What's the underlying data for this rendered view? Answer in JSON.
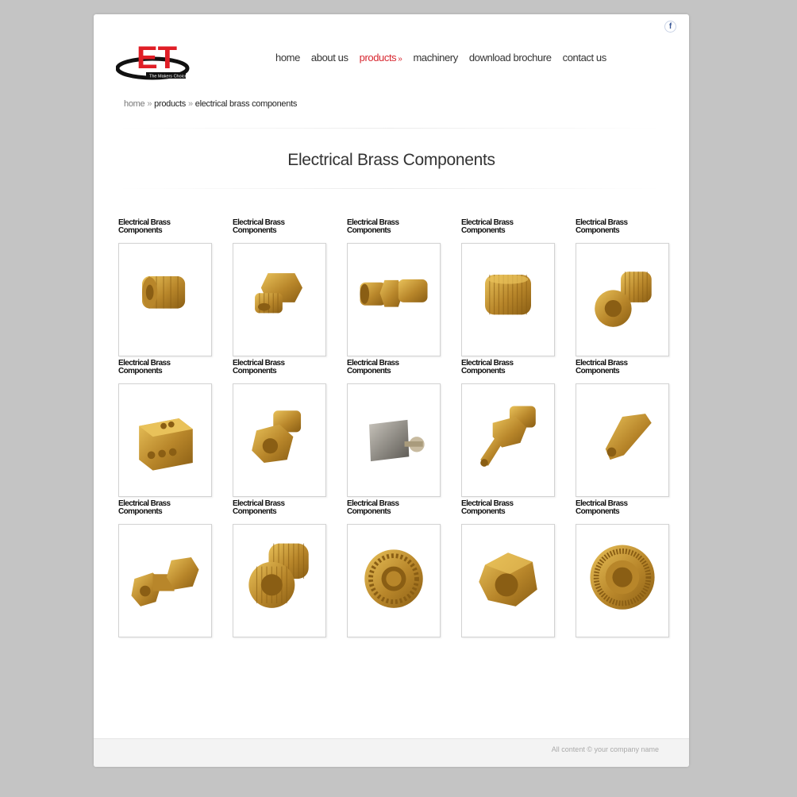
{
  "header": {
    "social_icon": "facebook-icon",
    "logo_letters": "ET",
    "logo_tagline": "The Makers Choice"
  },
  "nav": {
    "items": [
      "home",
      "about us",
      "products",
      "machinery",
      "download brochure",
      "contact us"
    ],
    "active_index": 2,
    "active_marker": "»"
  },
  "breadcrumb": {
    "items": [
      "home",
      "products",
      "electrical brass components"
    ],
    "separator": "»"
  },
  "page_title": "Electrical Brass Components",
  "products": {
    "caption": "Electrical Brass Components",
    "items": [
      {
        "caption": "Electrical Brass Components",
        "image": "slotted-hex-insert"
      },
      {
        "caption": "Electrical Brass Components",
        "image": "threaded-hex-fitting"
      },
      {
        "caption": "Electrical Brass Components",
        "image": "compression-coupling"
      },
      {
        "caption": "Electrical Brass Components",
        "image": "knurled-insert"
      },
      {
        "caption": "Electrical Brass Components",
        "image": "knurled-insert-threaded"
      },
      {
        "caption": "Electrical Brass Components",
        "image": "terminal-block"
      },
      {
        "caption": "Electrical Brass Components",
        "image": "hex-insert"
      },
      {
        "caption": "Electrical Brass Components",
        "image": "nickel-terminal-connector"
      },
      {
        "caption": "Electrical Brass Components",
        "image": "hose-nipple"
      },
      {
        "caption": "Electrical Brass Components",
        "image": "hex-spacer"
      },
      {
        "caption": "Electrical Brass Components",
        "image": "double-hex-spacer"
      },
      {
        "caption": "Electrical Brass Components",
        "image": "knurled-insert-large"
      },
      {
        "caption": "Electrical Brass Components",
        "image": "knurled-nut"
      },
      {
        "caption": "Electrical Brass Components",
        "image": "hex-nut"
      },
      {
        "caption": "Electrical Brass Components",
        "image": "knurled-round-nut"
      }
    ]
  },
  "footer": {
    "text": "All content © your company name"
  },
  "colors": {
    "accent": "#d7262f",
    "brass": "#c9a23a",
    "background": "#c4c4c4"
  }
}
